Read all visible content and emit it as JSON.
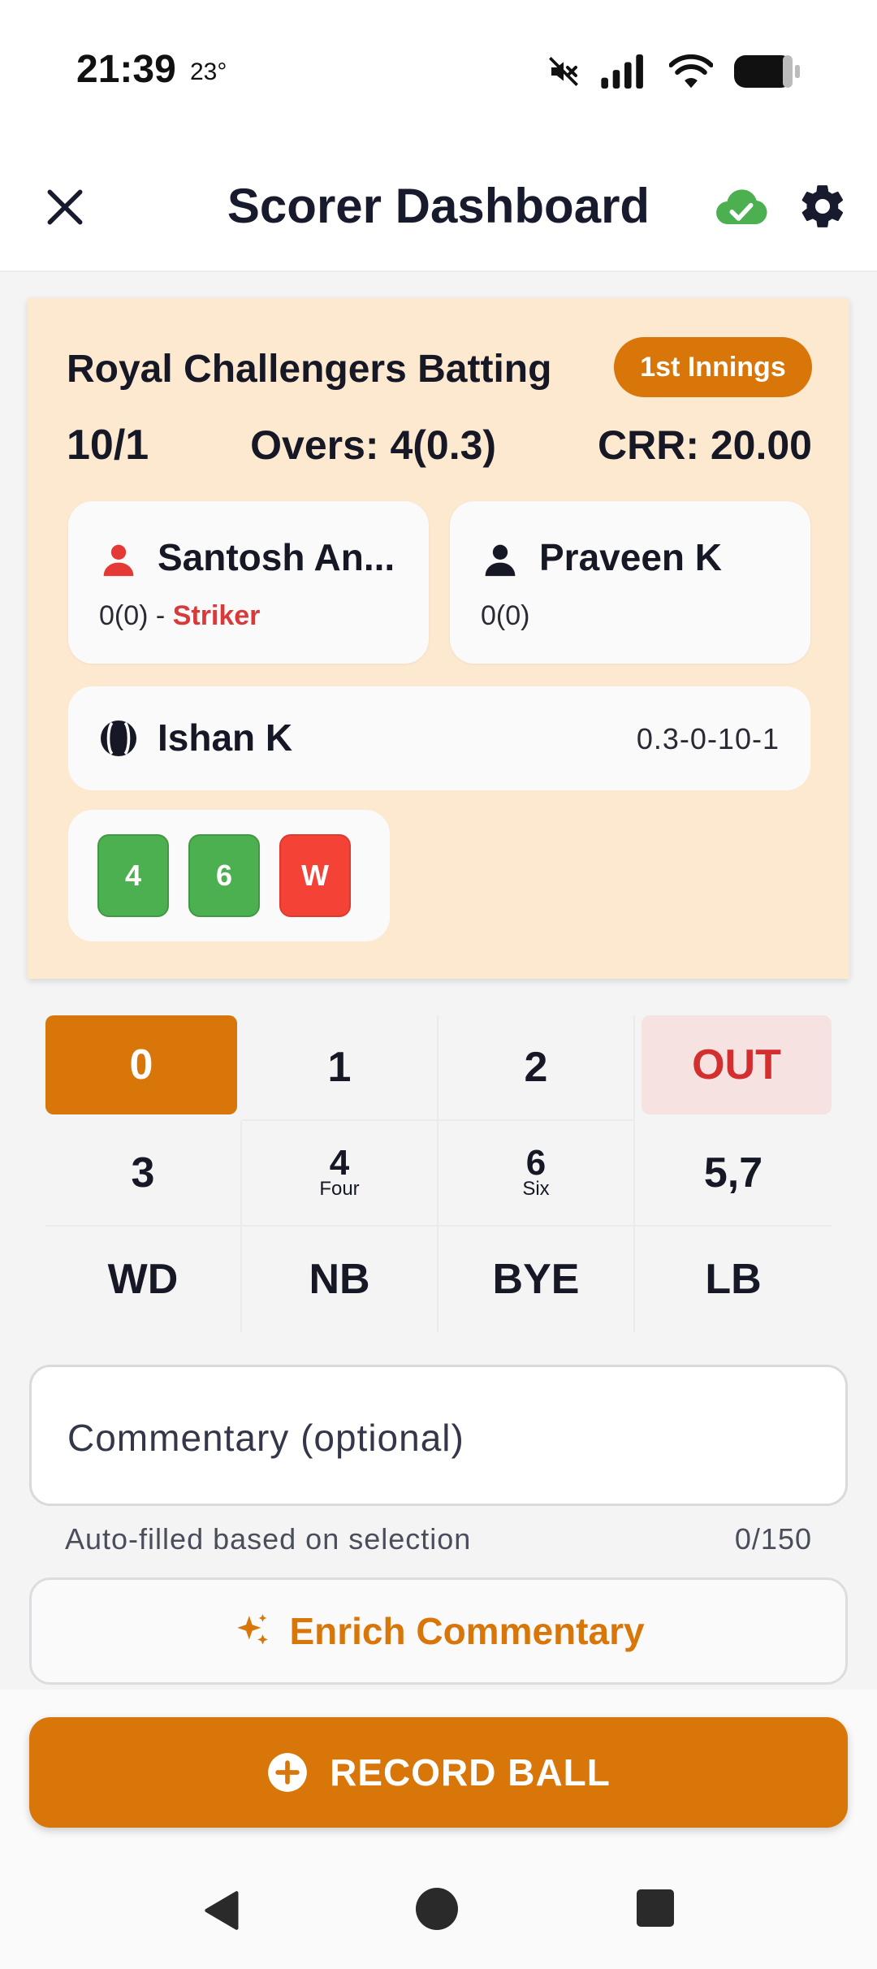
{
  "status_bar": {
    "time": "21:39",
    "temperature": "23°",
    "icons": [
      "mute-icon",
      "signal-icon",
      "wifi-icon",
      "battery-icon"
    ]
  },
  "app_bar": {
    "title": "Scorer Dashboard",
    "icons": [
      "close-icon",
      "cloud-synced-icon",
      "gear-icon"
    ]
  },
  "scoreboard": {
    "team_batting": "Royal Challengers Batting",
    "innings_badge": "1st Innings",
    "score": "10/1",
    "overs": "Overs: 4(0.3)",
    "crr": "CRR: 20.00"
  },
  "batsmen": [
    {
      "name": "Santosh An...",
      "stat": "0(0)",
      "role_separator": " - ",
      "role": "Striker",
      "icon": "person-icon"
    },
    {
      "name": "Praveen K",
      "stat": "0(0)",
      "icon": "person-icon"
    }
  ],
  "bowler": {
    "name": "Ishan K",
    "figures": "0.3-0-10-1",
    "icon": "cricket-ball-icon"
  },
  "this_over": [
    "4",
    "6",
    "W"
  ],
  "keypad": {
    "selected": "0",
    "keys": [
      {
        "label": "0",
        "sub": ""
      },
      {
        "label": "1",
        "sub": ""
      },
      {
        "label": "2",
        "sub": ""
      },
      {
        "label": "OUT",
        "sub": ""
      },
      {
        "label": "3",
        "sub": ""
      },
      {
        "label": "4",
        "sub": "Four"
      },
      {
        "label": "6",
        "sub": "Six"
      },
      {
        "label": "5,7",
        "sub": ""
      },
      {
        "label": "WD",
        "sub": ""
      },
      {
        "label": "NB",
        "sub": ""
      },
      {
        "label": "BYE",
        "sub": ""
      },
      {
        "label": "LB",
        "sub": ""
      }
    ]
  },
  "commentary": {
    "placeholder": "Commentary (optional)",
    "helper": "Auto-filled based on selection",
    "counter": "0/150"
  },
  "enrich_button": {
    "label": "Enrich Commentary",
    "icon": "sparkle-icon"
  },
  "record_button": {
    "label": "RECORD BALL",
    "icon": "plus-circle-icon"
  },
  "colors": {
    "accent": "#d9760a",
    "card_bg": "#fde8d0",
    "boundary": "#4caf50",
    "wicket": "#f44336",
    "striker": "#d83a3a",
    "synced": "#4caf50"
  }
}
